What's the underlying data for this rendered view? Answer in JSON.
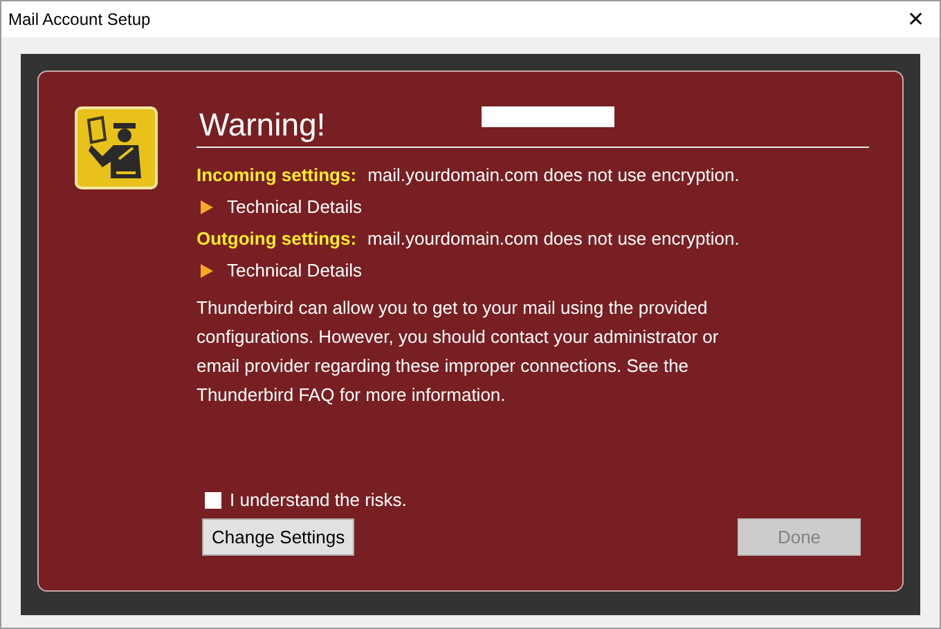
{
  "window": {
    "title": "Mail Account Setup",
    "close": "✕"
  },
  "warning": {
    "title": "Warning!",
    "settings": [
      {
        "label": "Incoming settings:",
        "text": "mail.yourdomain.com does not use encryption.",
        "details": {
          "label": "Technical Details",
          "expanded": false
        }
      },
      {
        "label": "Outgoing settings:",
        "text": "mail.yourdomain.com does not use encryption.",
        "details": {
          "label": "Technical Details",
          "expanded": false
        }
      }
    ],
    "message": "Thunderbird can allow you to get to your mail using the provided configurations. However, you should contact your administrator or email provider regarding these improper connections. See the Thunderbird FAQ for more information.",
    "risk_checkbox": {
      "label": "I understand the risks.",
      "checked": false
    },
    "buttons": [
      {
        "label": "Change Settings",
        "disabled": false
      },
      {
        "label": "Done",
        "disabled": true
      }
    ]
  }
}
